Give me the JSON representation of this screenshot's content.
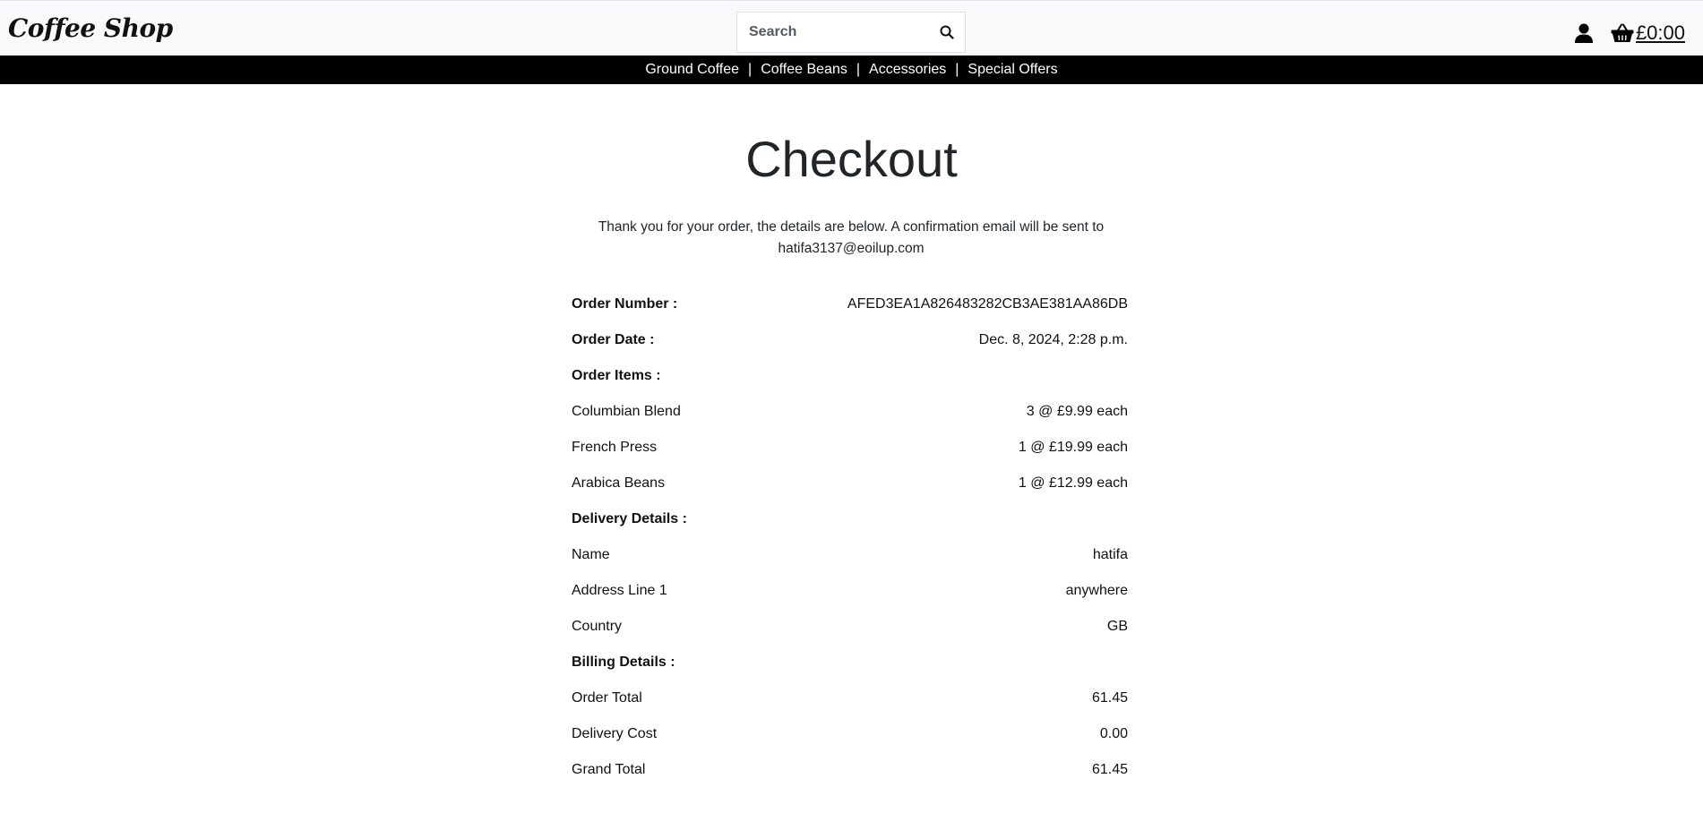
{
  "header": {
    "brand": "Coffee Shop",
    "search": {
      "placeholder": "Search",
      "value": ""
    },
    "icons": {
      "account": "user-icon",
      "basket": "basket-icon",
      "search": "search-icon"
    },
    "basket_total": "£0:00"
  },
  "nav": {
    "items": [
      {
        "label": "Ground Coffee"
      },
      {
        "label": "Coffee Beans"
      },
      {
        "label": "Accessories"
      },
      {
        "label": "Special Offers"
      }
    ],
    "separator": "|"
  },
  "main": {
    "title": "Checkout",
    "thanks_line1": "Thank you for your order, the details are below. A confirmation email will be sent to",
    "thanks_line2": "hatifa3137@eoilup.com",
    "order_number": {
      "label": "Order Number :",
      "value": "AFED3EA1A826483282CB3AE381AA86DB"
    },
    "order_date": {
      "label": "Order Date :",
      "value": "Dec. 8, 2024, 2:28 p.m."
    },
    "order_items_heading": "Order Items :",
    "order_items": [
      {
        "name": "Columbian Blend",
        "qty_price": "3 @ £9.99 each"
      },
      {
        "name": "French Press",
        "qty_price": "1 @ £19.99 each"
      },
      {
        "name": "Arabica Beans",
        "qty_price": "1 @ £12.99 each"
      }
    ],
    "delivery_heading": "Delivery Details :",
    "delivery": [
      {
        "label": "Name",
        "value": "hatifa"
      },
      {
        "label": "Address Line 1",
        "value": "anywhere"
      },
      {
        "label": "Country",
        "value": "GB"
      }
    ],
    "billing_heading": "Billing Details :",
    "billing": [
      {
        "label": "Order Total",
        "value": "61.45"
      },
      {
        "label": "Delivery Cost",
        "value": "0.00"
      },
      {
        "label": "Grand Total",
        "value": "61.45"
      }
    ]
  },
  "colors": {
    "header_bg": "#f8f9fa",
    "nav_bg": "#000000",
    "text": "#212529"
  }
}
